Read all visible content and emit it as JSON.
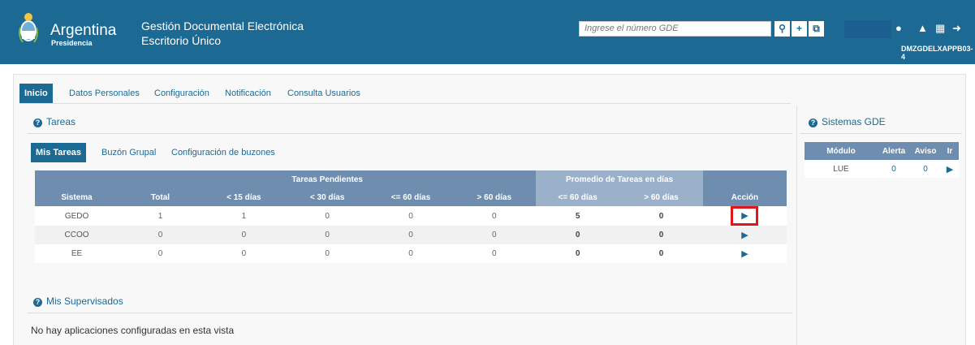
{
  "header": {
    "brand": "Argentina",
    "brand_sub": "Presidencia",
    "app_title": "Gestión Documental Electrónica",
    "app_subtitle": "Escritorio Único",
    "search_placeholder": "Ingrese el número GDE",
    "server": "DMZGDELXAPPB03-4"
  },
  "nav": {
    "tabs": [
      "Inicio",
      "Datos Personales",
      "Configuración",
      "Notificación",
      "Consulta Usuarios"
    ]
  },
  "tareas": {
    "title": "Tareas",
    "subtabs": [
      "Mis Tareas",
      "Buzón Grupal",
      "Configuración de buzones"
    ],
    "group_headers": {
      "pendientes": "Tareas Pendientes",
      "promedio": "Promedio de Tareas en días"
    },
    "columns": [
      "Sistema",
      "Total",
      "< 15 días",
      "< 30 días",
      "<= 60 días",
      "> 60 días",
      "<= 60 días",
      "> 60 días",
      "Acción"
    ],
    "rows": [
      {
        "sistema": "GEDO",
        "total": "1",
        "d15": "1",
        "d30": "0",
        "d60": "0",
        "dmas60": "0",
        "p60": "5",
        "pmas60": "0"
      },
      {
        "sistema": "CCOO",
        "total": "0",
        "d15": "0",
        "d30": "0",
        "d60": "0",
        "dmas60": "0",
        "p60": "0",
        "pmas60": "0"
      },
      {
        "sistema": "EE",
        "total": "0",
        "d15": "0",
        "d30": "0",
        "d60": "0",
        "dmas60": "0",
        "p60": "0",
        "pmas60": "0"
      }
    ]
  },
  "supervisados": {
    "title": "Mis Supervisados",
    "empty_text": "No hay aplicaciones configuradas en esta vista"
  },
  "sistemas": {
    "title": "Sistemas GDE",
    "columns": [
      "Módulo",
      "Alerta",
      "Aviso",
      "Ir"
    ],
    "rows": [
      {
        "modulo": "LUE",
        "alerta": "0",
        "aviso": "0"
      }
    ]
  },
  "colors": {
    "primary": "#1c6a93",
    "header_row": "#6f8dae",
    "header_row_light": "#9bb1c9",
    "highlight": "#e0161b"
  }
}
